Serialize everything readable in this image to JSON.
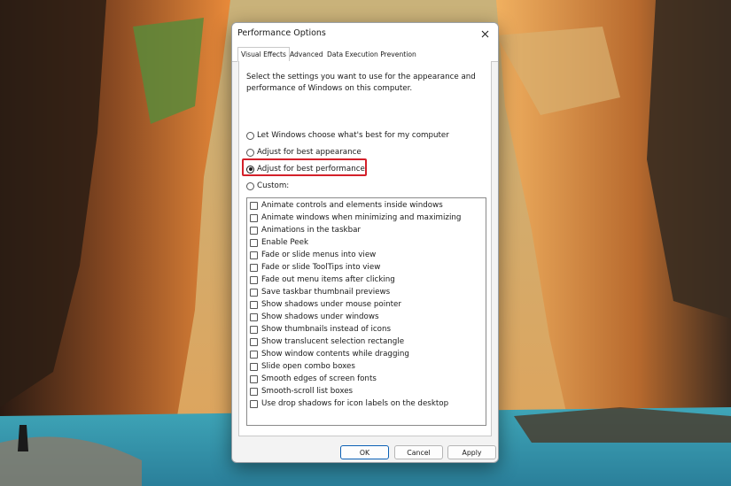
{
  "dialog": {
    "title": "Performance Options",
    "close_icon": "close-icon",
    "tabs": [
      {
        "label": "Visual Effects",
        "active": true
      },
      {
        "label": "Advanced",
        "active": false
      },
      {
        "label": "Data Execution Prevention",
        "active": false
      }
    ],
    "intro": "Select the settings you want to use for the appearance and performance of Windows on this computer.",
    "radio_options": [
      {
        "label": "Let Windows choose what's best for my computer",
        "checked": false
      },
      {
        "label": "Adjust for best appearance",
        "checked": false
      },
      {
        "label": "Adjust for best performance",
        "checked": true
      },
      {
        "label": "Custom:",
        "checked": false
      }
    ],
    "effects": [
      {
        "label": "Animate controls and elements inside windows",
        "checked": false
      },
      {
        "label": "Animate windows when minimizing and maximizing",
        "checked": false
      },
      {
        "label": "Animations in the taskbar",
        "checked": false
      },
      {
        "label": "Enable Peek",
        "checked": false
      },
      {
        "label": "Fade or slide menus into view",
        "checked": false
      },
      {
        "label": "Fade or slide ToolTips into view",
        "checked": false
      },
      {
        "label": "Fade out menu items after clicking",
        "checked": false
      },
      {
        "label": "Save taskbar thumbnail previews",
        "checked": false
      },
      {
        "label": "Show shadows under mouse pointer",
        "checked": false
      },
      {
        "label": "Show shadows under windows",
        "checked": false
      },
      {
        "label": "Show thumbnails instead of icons",
        "checked": false
      },
      {
        "label": "Show translucent selection rectangle",
        "checked": false
      },
      {
        "label": "Show window contents while dragging",
        "checked": false
      },
      {
        "label": "Slide open combo boxes",
        "checked": false
      },
      {
        "label": "Smooth edges of screen fonts",
        "checked": false
      },
      {
        "label": "Smooth-scroll list boxes",
        "checked": false
      },
      {
        "label": "Use drop shadows for icon labels on the desktop",
        "checked": false
      }
    ],
    "buttons": {
      "ok": "OK",
      "cancel": "Cancel",
      "apply": "Apply"
    },
    "highlight_color": "#d4202a"
  },
  "wallpaper": {
    "description_icon": "canyon-wallpaper"
  }
}
